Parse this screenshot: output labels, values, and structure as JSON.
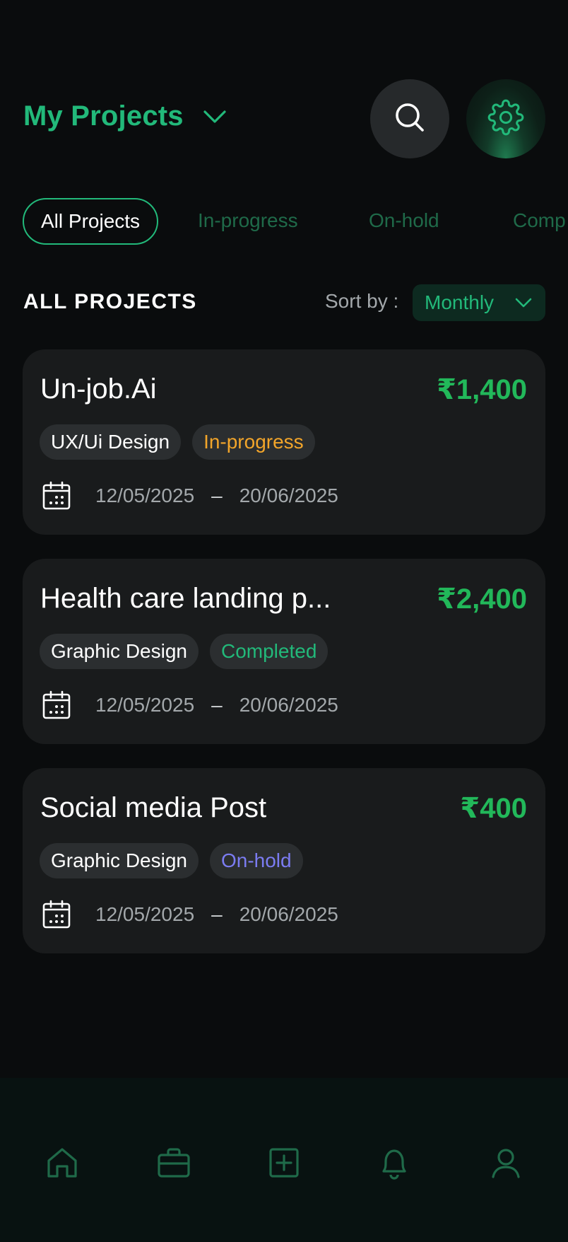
{
  "header": {
    "title": "My Projects",
    "title_icon": "chevron-down-icon",
    "search_icon": "search-icon",
    "settings_icon": "gear-icon",
    "accent": "#22b97a"
  },
  "tabs": [
    {
      "label": "All Projects",
      "active": true
    },
    {
      "label": "In-progress",
      "active": false
    },
    {
      "label": "On-hold",
      "active": false
    },
    {
      "label": "Comp",
      "active": false
    }
  ],
  "section": {
    "title": "ALL PROJECTS",
    "sort_label": "Sort by :",
    "sort_value": "Monthly"
  },
  "projects": [
    {
      "name": "Un-job.Ai",
      "amount": "₹1,400",
      "category": "UX/Ui Design",
      "status": "In-progress",
      "status_color": "#f2a52a",
      "start": "12/05/2025",
      "sep": "–",
      "end": "20/06/2025"
    },
    {
      "name": "Health  care landing p...",
      "amount": "₹2,400",
      "category": "Graphic Design",
      "status": "Completed",
      "status_color": "#22b97a",
      "start": "12/05/2025",
      "sep": "–",
      "end": "20/06/2025"
    },
    {
      "name": "Social media Post",
      "amount": "₹400",
      "category": "Graphic Design",
      "status": "On-hold",
      "status_color": "#7b7cf2",
      "start": "12/05/2025",
      "sep": "–",
      "end": "20/06/2025"
    }
  ],
  "bottom_nav": {
    "items": [
      "home-icon",
      "briefcase-icon",
      "add-square-icon",
      "bell-icon",
      "user-icon"
    ],
    "icon_color": "#1f6a49"
  }
}
